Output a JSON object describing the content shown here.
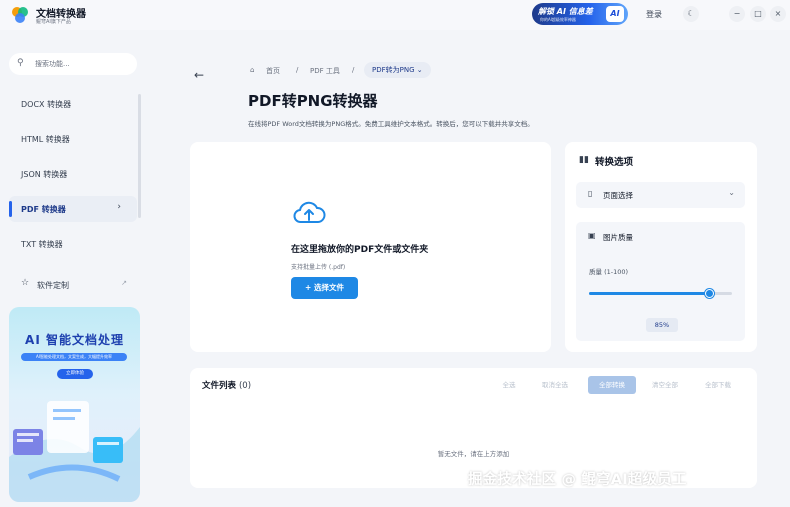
{
  "app": {
    "title": "文档转换器",
    "subtitle": "鲲穹AI旗下产品"
  },
  "topbar": {
    "promo": {
      "title": "解锁 AI 信息差",
      "subtitle": "你的AI超级效率神器",
      "badge": "AI"
    },
    "login_label": "登录",
    "icons": [
      "moon-icon",
      "minimize-icon",
      "maximize-icon",
      "close-icon"
    ],
    "icon_glyphs": {
      "moon": "☾",
      "minimize": "−",
      "maximize": "□",
      "close": "×"
    }
  },
  "sidebar": {
    "search_placeholder": "搜索功能...",
    "items": [
      {
        "label": "DOCX 转换器",
        "active": false
      },
      {
        "label": "HTML 转换器",
        "active": false
      },
      {
        "label": "JSON 转换器",
        "active": false
      },
      {
        "label": "PDF 转换器",
        "active": true
      },
      {
        "label": "TXT 转换器",
        "active": false
      }
    ],
    "custom_label": "软件定制",
    "banner": {
      "title": "AI 智能文档处理",
      "subtitle": "AI智能处理文档，文案生成，大幅提升效率",
      "button": "立即体验"
    }
  },
  "breadcrumb": {
    "home": "首页",
    "tools": "PDF 工具",
    "current": "PDF转为PNG"
  },
  "page": {
    "title": "PDF转PNG转换器",
    "description": "在线将PDF Word文档转换为PNG格式。免费工具维护文本格式。转换后，您可以下载并共享文档。"
  },
  "upload": {
    "title": "在这里拖放你的PDF文件或文件夹",
    "hint": "支持批量上传 (.pdf)",
    "button": "+ 选择文件"
  },
  "options": {
    "title": "转换选项",
    "page_select": "页面选择",
    "quality_title": "图片质量",
    "range_label": "质量 (1-100)",
    "quality_value": 85,
    "quality_display": "85%"
  },
  "files": {
    "title": "文件列表",
    "count": "(0)",
    "actions": [
      "全选",
      "取消全选",
      "全部转换",
      "清空全部",
      "全部下载"
    ],
    "empty": "暂无文件，请在上方添加"
  },
  "watermark": "掘金技术社区 @ 鲲穹AI超级员工",
  "colors": {
    "accent": "#1e88e5",
    "primary_dark": "#1e3a8a",
    "background": "#f3f5f9"
  }
}
